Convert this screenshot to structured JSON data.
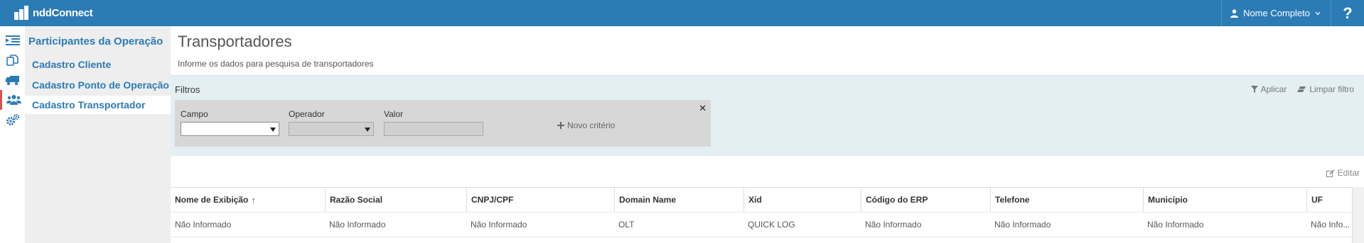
{
  "app": {
    "name": "nddConnect",
    "user_name": "Nome Completo",
    "help_label": "?"
  },
  "rail": {
    "icons": [
      "list-indent-icon",
      "copy-document-icon",
      "truck-icon",
      "users-group-icon",
      "gears-icon"
    ],
    "active_index": 3
  },
  "subnav": {
    "title": "Participantes da Operação",
    "items": [
      {
        "label": "Cadastro Cliente"
      },
      {
        "label": "Cadastro Ponto de Operação"
      },
      {
        "label": "Cadastro Transportador"
      }
    ]
  },
  "page": {
    "title": "Transportadores",
    "subtitle": "Informe os dados para pesquisa de transportadores"
  },
  "filters": {
    "title": "Filtros",
    "apply_label": "Aplicar",
    "clear_label": "Limpar filtro",
    "criterion": {
      "field_label": "Campo",
      "operator_label": "Operador",
      "value_label": "Valor",
      "field_value": "",
      "operator_value": "",
      "value_value": ""
    },
    "new_criterion_label": "Novo critério"
  },
  "toolbar": {
    "edit_label": "Editar"
  },
  "table": {
    "columns": [
      {
        "label": "Nome de Exibição"
      },
      {
        "label": "Razão Social"
      },
      {
        "label": "CNPJ/CPF"
      },
      {
        "label": "Domain Name"
      },
      {
        "label": "Xid"
      },
      {
        "label": "Código do ERP"
      },
      {
        "label": "Telefone"
      },
      {
        "label": "Município"
      },
      {
        "label": "UF"
      }
    ],
    "sort_indicator": "↑",
    "rows": [
      [
        "Não Informado",
        "Não Informado",
        "Não Informado",
        "OLT",
        "QUICK LOG",
        "Não Informado",
        "Não Informado",
        "Não Informado",
        "Não Info..."
      ]
    ]
  },
  "colors": {
    "brand": "#2b7bb5",
    "filter_bg": "#e3eff2",
    "active_marker": "#d9534f"
  }
}
